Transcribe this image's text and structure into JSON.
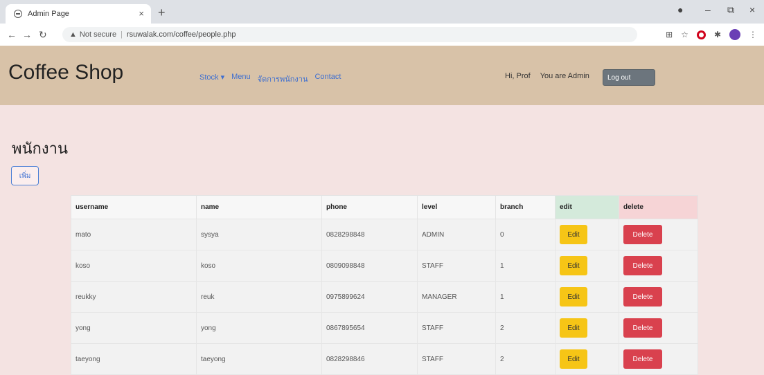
{
  "browser": {
    "tab_title": "Admin Page",
    "tab_close": "×",
    "new_tab": "+",
    "window_controls": [
      "–",
      "⧉",
      "×"
    ],
    "not_secure": "Not secure",
    "url": "rsuwalak.com/coffee/people.php"
  },
  "site": {
    "brand": "Coffee Shop",
    "menu": [
      "Stock ▾",
      "Menu",
      "จัดการพนักงาน",
      "Contact"
    ],
    "greeting": "Hi, Prof",
    "role": "You are Admin",
    "logout": "Log out"
  },
  "page": {
    "title": "พนักงาน",
    "add_button": "เพิ่ม"
  },
  "table": {
    "headers": [
      "username",
      "name",
      "phone",
      "level",
      "branch",
      "edit",
      "delete"
    ],
    "edit_label": "Edit",
    "delete_label": "Delete",
    "rows": [
      {
        "username": "mato",
        "name": "sysya",
        "phone": "0828298848",
        "level": "ADMIN",
        "branch": "0"
      },
      {
        "username": "koso",
        "name": "koso",
        "phone": "0809098848",
        "level": "STAFF",
        "branch": "1"
      },
      {
        "username": "reukky",
        "name": "reuk",
        "phone": "0975899624",
        "level": "MANAGER",
        "branch": "1"
      },
      {
        "username": "yong",
        "name": "yong",
        "phone": "0867895654",
        "level": "STAFF",
        "branch": "2"
      },
      {
        "username": "taeyong",
        "name": "taeyong",
        "phone": "0828298846",
        "level": "STAFF",
        "branch": "2"
      }
    ]
  }
}
